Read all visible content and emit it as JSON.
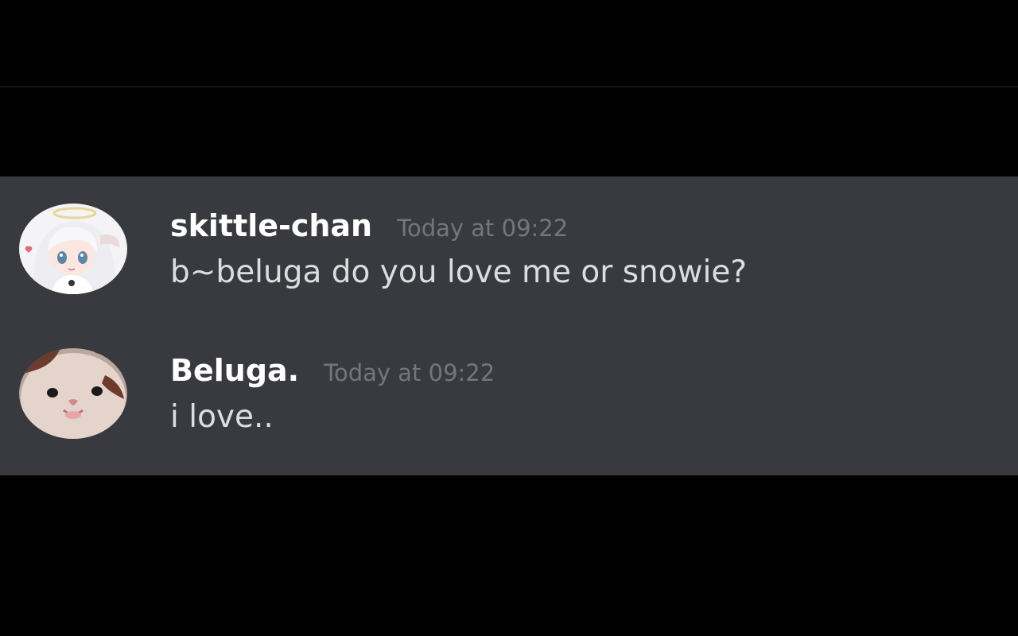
{
  "colors": {
    "background": "#000000",
    "panel": "#393a3f",
    "username": "#ffffff",
    "timestamp": "#72767d",
    "message_text": "#dcddde"
  },
  "messages": [
    {
      "username": "skittle-chan",
      "timestamp": "Today at 09:22",
      "text": "b~beluga do you love me or snowie?",
      "avatar": "anime-girl-avatar-icon"
    },
    {
      "username": "Beluga.",
      "timestamp": "Today at 09:22",
      "text": "i love..",
      "avatar": "cat-face-avatar-icon"
    }
  ]
}
